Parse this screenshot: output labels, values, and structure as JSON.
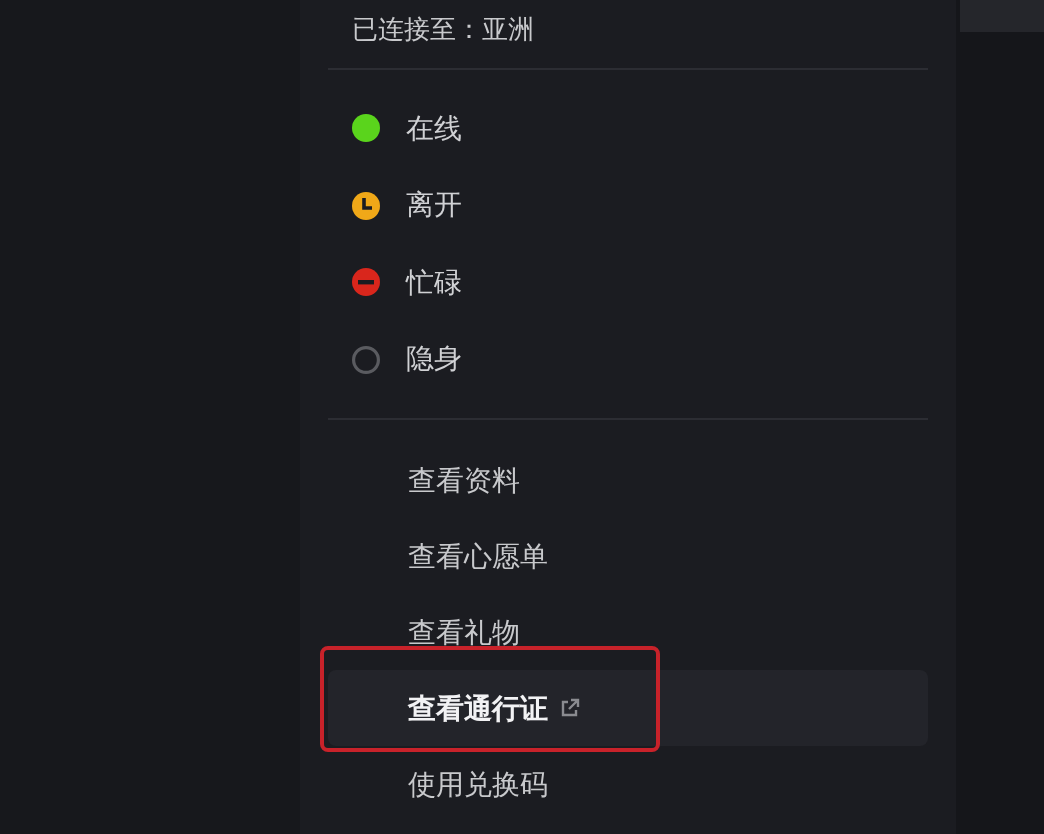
{
  "menu": {
    "connection": "已连接至：亚洲",
    "statuses": [
      {
        "kind": "online",
        "label": "在线",
        "color": "#5ad41c"
      },
      {
        "kind": "away",
        "label": "离开",
        "color": "#f0a818"
      },
      {
        "kind": "busy",
        "label": "忙碌",
        "color": "#d9261c"
      },
      {
        "kind": "invisible",
        "label": "隐身",
        "color": "#5a5b60"
      }
    ],
    "items": [
      {
        "label": "查看资料",
        "highlighted": false,
        "external": false,
        "annotated": false
      },
      {
        "label": "查看心愿单",
        "highlighted": false,
        "external": false,
        "annotated": false
      },
      {
        "label": "查看礼物",
        "highlighted": false,
        "external": false,
        "annotated": false
      },
      {
        "label": "查看通行证",
        "highlighted": true,
        "external": true,
        "annotated": true
      },
      {
        "label": "使用兑换码",
        "highlighted": false,
        "external": false,
        "annotated": false
      }
    ]
  }
}
